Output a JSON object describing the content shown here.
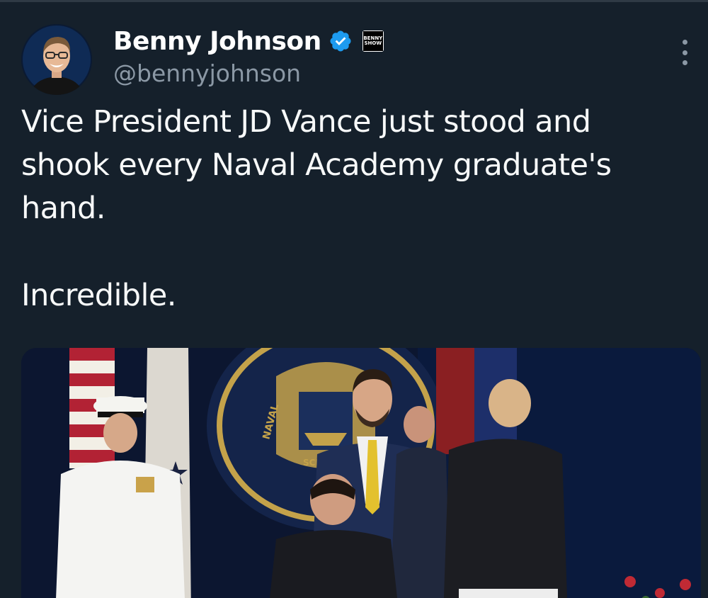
{
  "author": {
    "display_name": "Benny Johnson",
    "handle": "@bennyjohnson",
    "verified_icon": "verified-badge-icon",
    "affiliate_badge_text": "BENNY SHOW",
    "colors": {
      "verified": "#1d9bf0",
      "handle": "#8b98a5"
    }
  },
  "tweet": {
    "lines": [
      "Vice President JD Vance just stood and",
      "shook every Naval Academy graduate's",
      "hand."
    ],
    "closing": "Incredible."
  },
  "media": {
    "kind": "video-thumbnail",
    "seal_text": "NAVAL",
    "seal_text_bottom": "SCI"
  },
  "theme": {
    "background": "#15202b",
    "text": "#f7f9f9"
  }
}
